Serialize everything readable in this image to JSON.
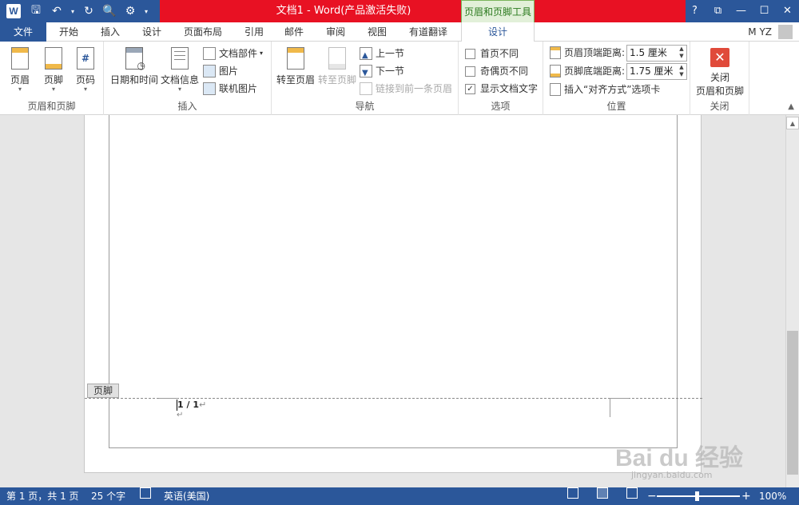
{
  "app": {
    "title": "文档1 -  Word(产品激活失败)",
    "context_tab": "页眉和页脚工具",
    "user": "M YZ",
    "help": "?",
    "window_buttons": [
      "?",
      "⧉",
      "—",
      "☐",
      "✕"
    ]
  },
  "tabs": [
    {
      "label": "文件"
    },
    {
      "label": "开始"
    },
    {
      "label": "插入"
    },
    {
      "label": "设计"
    },
    {
      "label": "页面布局"
    },
    {
      "label": "引用"
    },
    {
      "label": "邮件"
    },
    {
      "label": "审阅"
    },
    {
      "label": "视图"
    },
    {
      "label": "有道翻译"
    },
    {
      "label": "设计"
    }
  ],
  "ribbon": {
    "hf_group": {
      "label": "页眉和页脚",
      "header": "页眉",
      "footer": "页脚",
      "page_number": "页码"
    },
    "insert_group": {
      "label": "插入",
      "date_time": "日期和时间",
      "doc_info": "文档信息",
      "doc_parts": "文档部件",
      "picture": "图片",
      "online_picture": "联机图片"
    },
    "nav_group": {
      "label": "导航",
      "goto_header": "转至页眉",
      "goto_footer": "转至页脚",
      "prev_section": "上一节",
      "next_section": "下一节",
      "link_previous": "链接到前一条页眉"
    },
    "options_group": {
      "label": "选项",
      "different_first": "首页不同",
      "different_odd_even": "奇偶页不同",
      "show_doc_text": "显示文档文字",
      "different_first_checked": false,
      "different_odd_even_checked": false,
      "show_doc_text_checked": true
    },
    "position_group": {
      "label": "位置",
      "header_from_top_label": "页眉顶端距离:",
      "header_from_top_value": "1.5 厘米",
      "footer_from_bottom_label": "页脚底端距离:",
      "footer_from_bottom_value": "1.75 厘米",
      "insert_align_tab": "插入“对齐方式”选项卡"
    },
    "close_group": {
      "label": "关闭",
      "close_line1": "关闭",
      "close_line2": "页眉和页脚"
    }
  },
  "document": {
    "footer_tag": "页脚",
    "page_number_text": "1 / 1",
    "paragraph_mark": "↵"
  },
  "watermark": {
    "brand": "Bai du 经验",
    "url": "jingyan.baidu.com"
  },
  "status": {
    "page": "第 1 页，共 1 页",
    "words": "25 个字",
    "language": "英语(美国)",
    "zoom": "100%"
  },
  "colors": {
    "word_blue": "#2b579a",
    "title_red": "#e81123",
    "context_green": "#e2f0d9"
  }
}
